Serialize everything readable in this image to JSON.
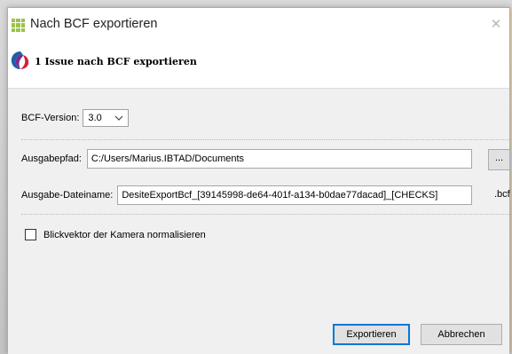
{
  "window": {
    "title": "Nach BCF exportieren",
    "close_glyph": "✕"
  },
  "header": {
    "title": "1 Issue nach BCF exportieren"
  },
  "form": {
    "version_label": "BCF-Version:",
    "version_value": "3.0",
    "path_label": "Ausgabepfad:",
    "path_value": "C:/Users/Marius.IBTAD/Documents",
    "browse_label": "...",
    "file_label": "Ausgabe-Dateiname:",
    "file_value": "DesiteExportBcf_[39145998-de64-401f-a134-b0dae77dacad]_[CHECKS]",
    "file_ext": ".bcf",
    "checkbox_label": "Blickvektor der Kamera normalisieren",
    "checkbox_checked": false
  },
  "footer": {
    "export_button": "Exportieren",
    "cancel_button": "Abbrechen"
  },
  "colors": {
    "accent": "#0078d7",
    "window_border": "#e8a33d",
    "app_icon": "#9bc34a"
  },
  "icons": {
    "app": "grid-app-icon",
    "header": "desite-logo-icon",
    "close": "close-icon",
    "dropdown": "chevron-down-icon"
  }
}
